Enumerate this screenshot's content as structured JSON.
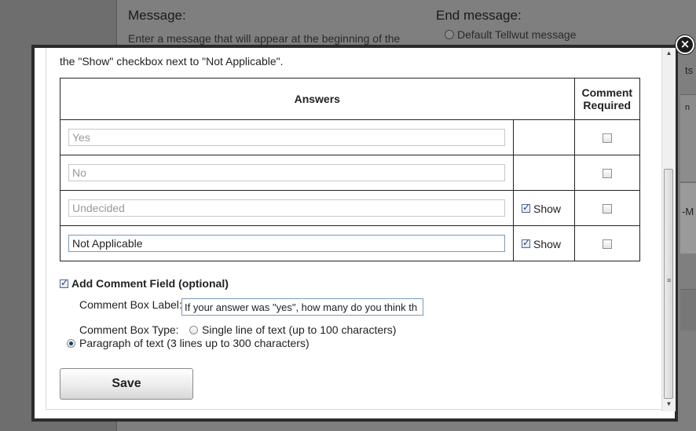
{
  "background": {
    "message_heading": "Message:",
    "message_text": "Enter a message that will appear at the beginning of the",
    "end_message_heading": "End message:",
    "end_message_option": "Default Tellwut message",
    "right_fragment_1": "ts",
    "right_fragment_2": "n",
    "right_fragment_3": "-M"
  },
  "modal": {
    "instruction_tail": "the \"Show\" checkbox next to \"Not Applicable\".",
    "table": {
      "header_answers": "Answers",
      "header_comment_line1": "Comment",
      "header_comment_line2": "Required",
      "show_label": "Show",
      "rows": [
        {
          "value": "Yes",
          "show": null,
          "comment_required": false
        },
        {
          "value": "No",
          "show": null,
          "comment_required": false
        },
        {
          "value": "Undecided",
          "show": true,
          "comment_required": false
        },
        {
          "value": "Not Applicable",
          "show": true,
          "comment_required": false
        }
      ]
    },
    "add_comment_label": "Add Comment Field (optional)",
    "add_comment_checked": true,
    "comment_box_label": "Comment Box Label:",
    "comment_box_value": "If your answer was \"yes\", how many do you think th",
    "comment_box_type_label": "Comment Box Type:",
    "type_option_single": "Single line of text (up to 100 characters)",
    "type_option_paragraph": "Paragraph of text (3 lines up to 300 characters)",
    "selected_type": "paragraph",
    "save_label": "Save",
    "close_glyph": "×"
  }
}
